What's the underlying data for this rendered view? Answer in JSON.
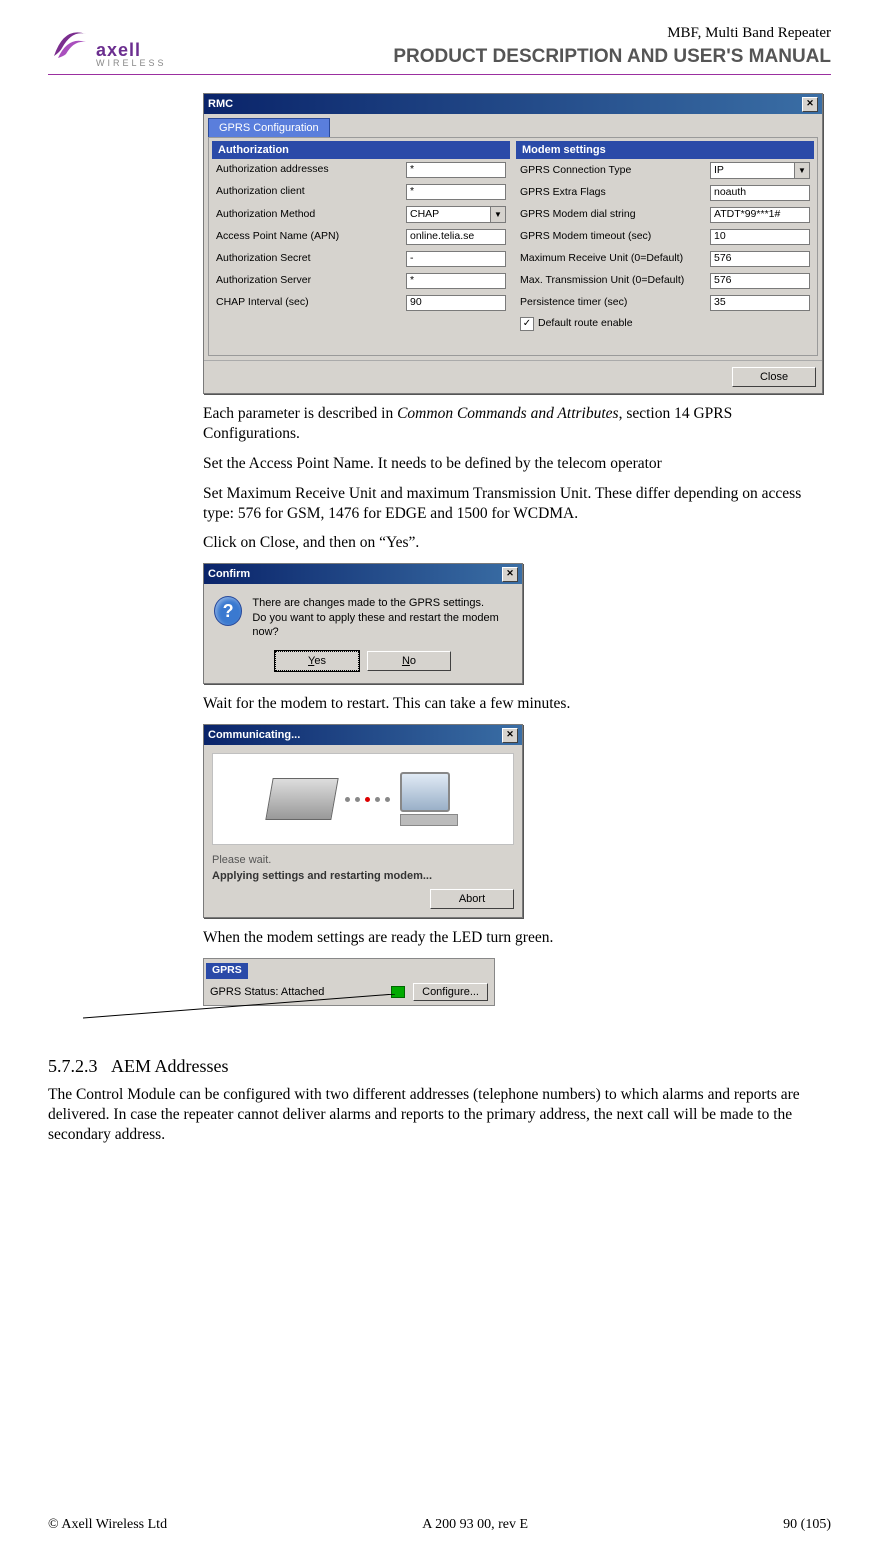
{
  "header": {
    "brand_top": "axell",
    "brand_bottom": "WIRELESS",
    "product_top": "MBF, Multi Band Repeater",
    "product_sub": "PRODUCT DESCRIPTION AND USER'S MANUAL"
  },
  "rmc": {
    "title": "RMC",
    "tab": "GPRS Configuration",
    "close_label": "Close",
    "authorization": {
      "header": "Authorization",
      "fields": {
        "addresses": {
          "label": "Authorization addresses",
          "value": "*"
        },
        "client": {
          "label": "Authorization client",
          "value": "*"
        },
        "method": {
          "label": "Authorization Method",
          "value": "CHAP"
        },
        "apn": {
          "label": "Access Point Name (APN)",
          "value": "online.telia.se"
        },
        "secret": {
          "label": "Authorization Secret",
          "value": "-"
        },
        "server": {
          "label": "Authorization Server",
          "value": "*"
        },
        "chap_int": {
          "label": "CHAP Interval (sec)",
          "value": "90"
        }
      }
    },
    "modem": {
      "header": "Modem settings",
      "fields": {
        "conn_type": {
          "label": "GPRS Connection Type",
          "value": "IP"
        },
        "extra_flags": {
          "label": "GPRS Extra Flags",
          "value": "noauth"
        },
        "dial": {
          "label": "GPRS Modem dial string",
          "value": "ATDT*99***1#"
        },
        "timeout": {
          "label": "GPRS Modem timeout (sec)",
          "value": "10"
        },
        "mru": {
          "label": "Maximum Receive Unit (0=Default)",
          "value": "576"
        },
        "mtu": {
          "label": "Max. Transmission Unit (0=Default)",
          "value": "576"
        },
        "persist": {
          "label": "Persistence timer (sec)",
          "value": "35"
        },
        "route": {
          "label": "Default route enable"
        }
      }
    }
  },
  "para": {
    "p1a": "Each parameter is described in ",
    "p1b": "Common Commands and Attributes",
    "p1c": ", section 14 GPRS Configurations.",
    "p2": "Set the Access Point Name. It needs to be defined by the telecom operator",
    "p3": "Set Maximum Receive Unit and maximum Transmission Unit. These differ depending on access type: 576 for GSM, 1476 for EDGE and 1500 for WCDMA.",
    "p4": "Click on Close, and then on “Yes”.",
    "p5": "Wait for the modem to restart. This can take a few minutes.",
    "p6": "When the modem settings are ready the LED turn green."
  },
  "confirm": {
    "title": "Confirm",
    "msg1": "There are changes made to the GPRS settings.",
    "msg2": "Do you want to apply these and restart the modem now?",
    "yes": "Yes",
    "no": "No"
  },
  "comm": {
    "title": "Communicating...",
    "line1": "Please wait.",
    "line2": "Applying settings and restarting modem...",
    "abort": "Abort"
  },
  "gprs": {
    "header": "GPRS",
    "status": "GPRS Status: Attached",
    "configure": "Configure..."
  },
  "section": {
    "num": "5.7.2.3",
    "title": "AEM Addresses",
    "body": "The Control Module can be configured with two different addresses (telephone numbers) to which alarms and reports are delivered. In case the repeater cannot deliver alarms and reports to the primary address, the next call will be made to the secondary address."
  },
  "footer": {
    "left": "© Axell Wireless Ltd",
    "mid": "A 200 93 00, rev E",
    "right": "90 (105)"
  }
}
